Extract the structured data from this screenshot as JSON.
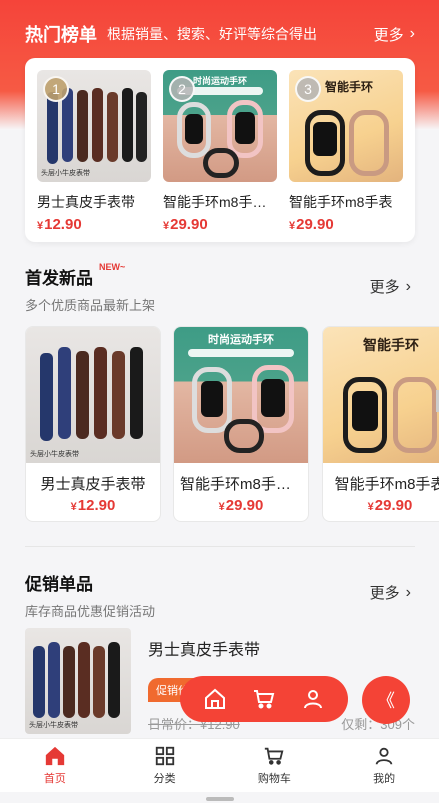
{
  "hot": {
    "title": "热门榜单",
    "subtitle": "根据销量、搜索、好评等综合得出",
    "more": "更多",
    "items": [
      {
        "rank": "1",
        "name": "男士真皮手表带",
        "price": "12.90",
        "currency": "¥"
      },
      {
        "rank": "2",
        "name": "智能手环m8手环…",
        "price": "29.90",
        "currency": "¥"
      },
      {
        "rank": "3",
        "name": "智能手环m8手表",
        "price": "29.90",
        "currency": "¥"
      }
    ]
  },
  "new_arrivals": {
    "title": "首发新品",
    "badge": "NEW~",
    "subtitle": "多个优质商品最新上架",
    "more": "更多",
    "items": [
      {
        "name": "男士真皮手表带",
        "price": "12.90",
        "currency": "¥"
      },
      {
        "name": "智能手环m8手环…",
        "price": "29.90",
        "currency": "¥"
      },
      {
        "name": "智能手环m8手表",
        "price": "29.90",
        "currency": "¥"
      }
    ]
  },
  "promo": {
    "title": "促销单品",
    "subtitle": "库存商品优惠促销活动",
    "more": "更多",
    "item": {
      "name": "男士真皮手表带",
      "badge": "促销价",
      "original_price": "日常价：¥12.90",
      "stock": "仅剩：309个"
    }
  },
  "art": {
    "strap_caption": "头层小牛皮表带",
    "band_title": "时尚运动手环",
    "peach_title": "智能手环"
  },
  "floating": {
    "home_icon": "home-icon",
    "cart_icon": "cart-icon",
    "user_icon": "user-icon",
    "toggle": "《"
  },
  "tabbar": {
    "items": [
      {
        "label": "首页",
        "icon": "home-icon",
        "active": true
      },
      {
        "label": "分类",
        "icon": "grid-icon",
        "active": false
      },
      {
        "label": "购物车",
        "icon": "cart-icon",
        "active": false
      },
      {
        "label": "我的",
        "icon": "user-icon",
        "active": false
      }
    ]
  },
  "colors": {
    "accent": "#f44336",
    "price": "#e53935",
    "promo_badge": "#f06a2f"
  }
}
